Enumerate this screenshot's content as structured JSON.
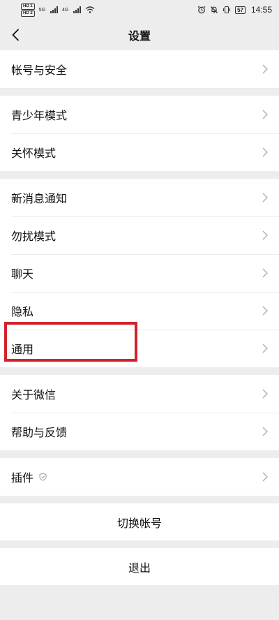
{
  "status_bar": {
    "hd1": "HD 1",
    "hd2": "HD 2",
    "net1": "5G",
    "net2": "4G",
    "battery": "57",
    "time": "14:55"
  },
  "header": {
    "title": "设置"
  },
  "groups": [
    {
      "items": [
        {
          "label": "帐号与安全"
        }
      ]
    },
    {
      "items": [
        {
          "label": "青少年模式"
        },
        {
          "label": "关怀模式"
        }
      ]
    },
    {
      "items": [
        {
          "label": "新消息通知"
        },
        {
          "label": "勿扰模式"
        },
        {
          "label": "聊天"
        },
        {
          "label": "隐私"
        },
        {
          "label": "通用"
        }
      ]
    },
    {
      "items": [
        {
          "label": "关于微信"
        },
        {
          "label": "帮助与反馈"
        }
      ]
    },
    {
      "items": [
        {
          "label": "插件"
        }
      ]
    }
  ],
  "actions": {
    "switch_account": "切换帐号",
    "logout": "退出"
  },
  "icons": {
    "back": "chevron-left-icon",
    "chevron": "chevron-right-icon",
    "plugin_badge": "shield-icon"
  },
  "colors": {
    "background": "#ededed",
    "row": "#ffffff",
    "highlight": "#d0232b",
    "chevron": "#b2b2b2"
  }
}
